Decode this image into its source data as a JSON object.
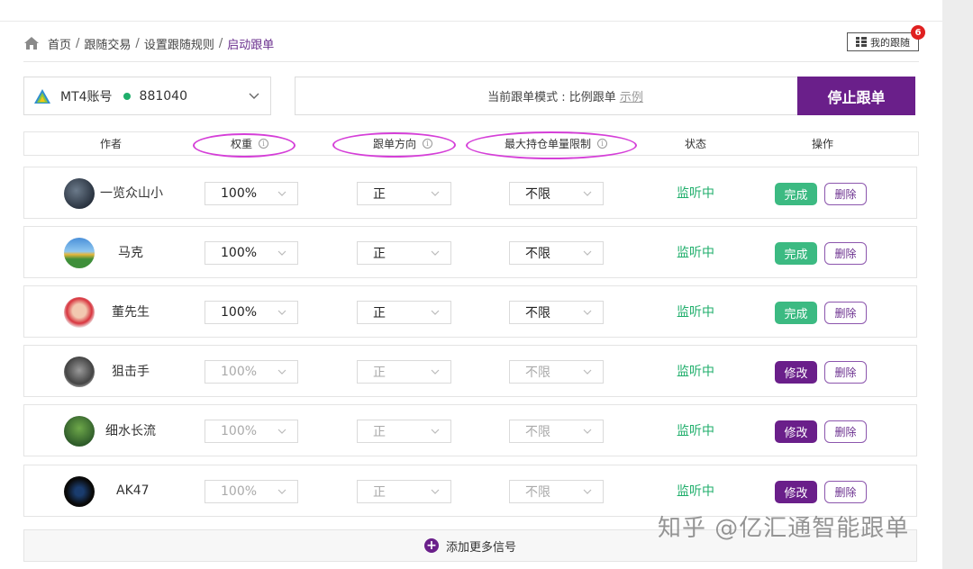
{
  "breadcrumb": {
    "items": [
      "首页",
      "跟随交易",
      "设置跟随规则"
    ],
    "separator": "/",
    "current": "启动跟单"
  },
  "my_follow": {
    "label": "我的跟随",
    "badge_count": "6"
  },
  "account": {
    "label": "MT4账号",
    "number": "881040",
    "status_color": "#1fae6b"
  },
  "mode": {
    "label": "当前跟单模式 : 比例跟单",
    "example_link": "示例"
  },
  "stop_button": "停止跟单",
  "table": {
    "headers": {
      "author": "作者",
      "weight": "权重",
      "direction": "跟单方向",
      "max_limit": "最大持仓单量限制",
      "status": "状态",
      "action": "操作"
    },
    "rows": [
      {
        "name": "一览众山小",
        "weight": "100%",
        "direction": "正",
        "max_limit": "不限",
        "status": "监听中",
        "primary_action": "完成",
        "primary_type": "done",
        "delete": "删除",
        "enabled": true
      },
      {
        "name": "马克",
        "weight": "100%",
        "direction": "正",
        "max_limit": "不限",
        "status": "监听中",
        "primary_action": "完成",
        "primary_type": "done",
        "delete": "删除",
        "enabled": true
      },
      {
        "name": "董先生",
        "weight": "100%",
        "direction": "正",
        "max_limit": "不限",
        "status": "监听中",
        "primary_action": "完成",
        "primary_type": "done",
        "delete": "删除",
        "enabled": true
      },
      {
        "name": "狙击手",
        "weight": "100%",
        "direction": "正",
        "max_limit": "不限",
        "status": "监听中",
        "primary_action": "修改",
        "primary_type": "edit",
        "delete": "删除",
        "enabled": false
      },
      {
        "name": "细水长流",
        "weight": "100%",
        "direction": "正",
        "max_limit": "不限",
        "status": "监听中",
        "primary_action": "修改",
        "primary_type": "edit",
        "delete": "删除",
        "enabled": false
      },
      {
        "name": "AK47",
        "weight": "100%",
        "direction": "正",
        "max_limit": "不限",
        "status": "监听中",
        "primary_action": "修改",
        "primary_type": "edit",
        "delete": "删除",
        "enabled": false
      }
    ]
  },
  "add_more": "添加更多信号",
  "watermark": "知乎 @亿汇通智能跟单",
  "colors": {
    "brand_purple": "#6a1f8a",
    "done_green": "#3cba82",
    "status_green": "#1fae6b",
    "highlight_magenta": "#d53fd8"
  }
}
